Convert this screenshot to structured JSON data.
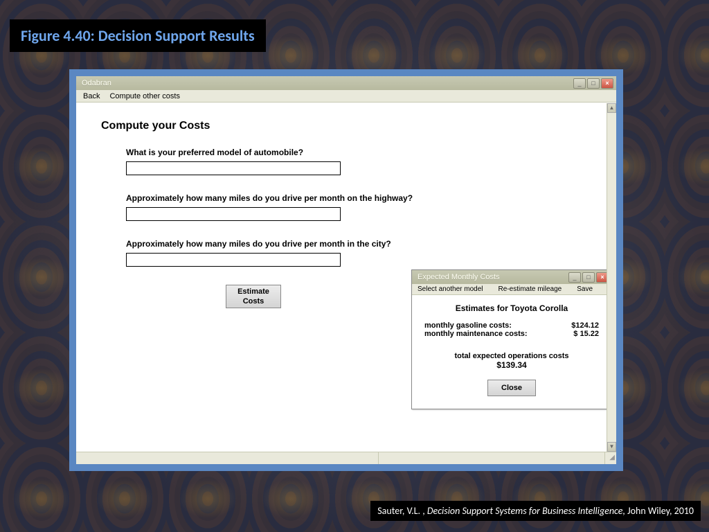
{
  "caption": "Figure 4.40:  Decision Support Results",
  "main_window": {
    "title": "Odabran",
    "menu": {
      "back": "Back",
      "compute_other": "Compute other costs"
    },
    "heading": "Compute your Costs",
    "questions": {
      "model": "What is your preferred model of automobile?",
      "highway": "Approximately how many miles do you drive per month on the highway?",
      "city": "Approximately how many miles do you drive per month in the city?"
    },
    "inputs": {
      "model": "",
      "highway": "",
      "city": ""
    },
    "estimate_button": "Estimate\nCosts"
  },
  "popup": {
    "title": "Expected Monthly Costs",
    "menu": {
      "select_another": "Select another model",
      "reestimate": "Re-estimate mileage",
      "save": "Save"
    },
    "heading": "Estimates for Toyota Corolla",
    "rows": {
      "gas_label": "monthly gasoline costs:",
      "gas_value": "$124.12",
      "maint_label": "monthly maintenance costs:",
      "maint_value": "$ 15.22"
    },
    "total_label": "total expected operations costs",
    "total_value": "$139.34",
    "close_button": "Close"
  },
  "citation": {
    "author": "Sauter, V.L. , ",
    "title": "Decision Support Systems for Business Intelligence, ",
    "pub": "John Wiley, 2010"
  }
}
